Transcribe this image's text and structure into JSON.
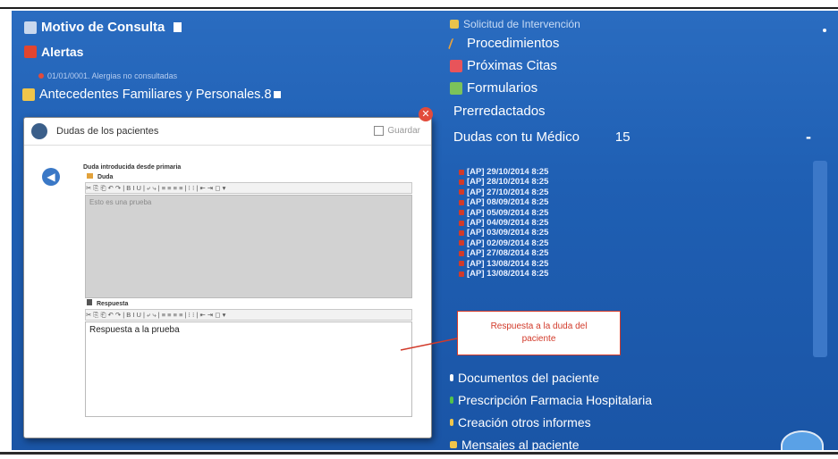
{
  "left": {
    "motivo": "Motivo de Consulta",
    "alertas": "Alertas",
    "alerta_item": "01/01/0001. Alergias no consultadas",
    "antecedentes": "Antecedentes Familiares y Personales.8"
  },
  "right": {
    "solicitud": "Solicitud de Intervención",
    "procedimientos": "Procedimientos",
    "proximas_citas": "Próximas Citas",
    "formularios": "Formularios",
    "prerredactados": "Prerredactados",
    "dudas_title": "Dudas con tu Médico",
    "dudas_count": "15",
    "dudas_collapse": "-",
    "dudas_items": [
      "[AP] 29/10/2014 8:25",
      "[AP] 28/10/2014 8:25",
      "[AP] 27/10/2014 8:25",
      "[AP] 08/09/2014 8:25",
      "[AP] 05/09/2014 8:25",
      "[AP] 04/09/2014 8:25",
      "[AP] 03/09/2014 8:25",
      "[AP] 02/09/2014 8:25",
      "[AP] 27/08/2014 8:25",
      "[AP] 13/08/2014 8:25",
      "[AP] 13/08/2014 8:25"
    ],
    "documentos": "Documentos del paciente",
    "prescripcion": "Prescripción Farmacia Hospitalaria",
    "creacion": "Creación otros informes",
    "mensajes": "Mensajes al paciente"
  },
  "dialog": {
    "title": "Dudas de los pacientes",
    "save": "Guardar",
    "intro_label": "Duda introducida desde primaria",
    "duda_label": "Duda",
    "duda_text": "Esto es una prueba",
    "respuesta_label": "Respuesta",
    "respuesta_text": "Respuesta a la prueba",
    "toolbar_glyphs": "✂ ⎘ ⎗ ↶ ↷ | B I U | ⤶ ⤷ | ≡ ≡ ≡ ≡ | ⁝ ⁝ | ⇤ ⇥ ◻ ▾"
  },
  "callout": {
    "line1": "Respuesta a la duda del",
    "line2": "paciente"
  },
  "colors": {
    "background_blue": "#1f5fb3",
    "callout_red": "#d23a2a",
    "close_red": "#e24b3b"
  }
}
